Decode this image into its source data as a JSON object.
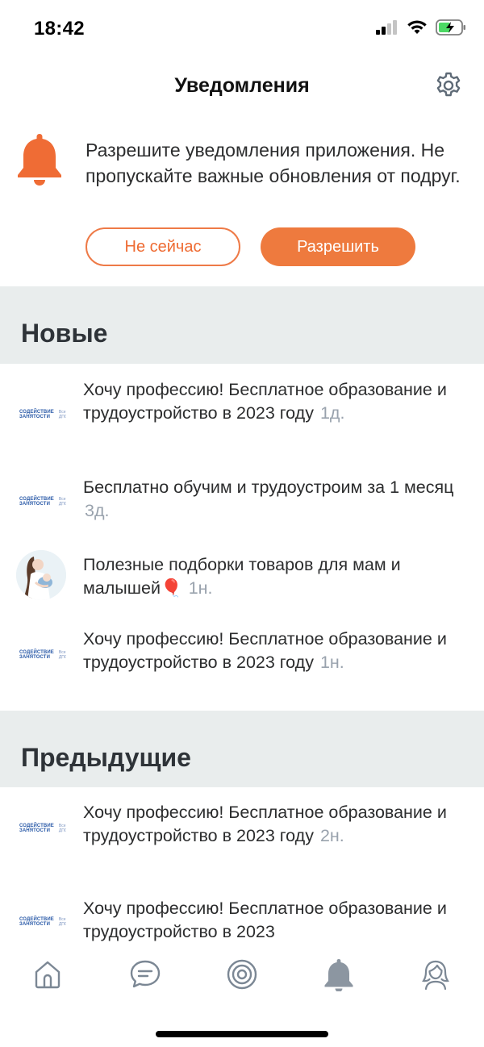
{
  "status_bar": {
    "time": "18:42"
  },
  "header": {
    "title": "Уведомления"
  },
  "banner": {
    "text": "Разрешите уведомления приложения. Не пропускайте важные обновления от подруг.",
    "later_label": "Не сейчас",
    "allow_label": "Разрешить"
  },
  "sections": {
    "new_title": "Новые",
    "previous_title": "Предыдущие"
  },
  "brand_logo": {
    "main": "СОДЕЙСТВИЕ ЗАНЯТОСТИ",
    "sub": "Все ДПО"
  },
  "notifications": [
    {
      "text": "Хочу профессию! Бесплатное образование и трудоустройство в 2023 году",
      "time": "1д."
    },
    {
      "text": "Бесплатно обучим и трудоустроим за 1 месяц",
      "time": "3д."
    },
    {
      "text": "Полезные подборки товаров для мам и малышей🎈",
      "time": "1н."
    },
    {
      "text": "Хочу профессию! Бесплатное образование и трудоустройство в 2023 году",
      "time": "1н."
    },
    {
      "text": "Хочу профессию! Бесплатное образование и трудоустройство в 2023 году",
      "time": "2н."
    },
    {
      "text": "Хочу профессию! Бесплатное образование и трудоустройство в 2023",
      "time": ""
    }
  ],
  "tabbar": {
    "icons": [
      "home-icon",
      "chat-icon",
      "target-icon",
      "bell-icon",
      "profile-icon"
    ],
    "active": "bell-icon"
  },
  "colors": {
    "accent": "#ee7a3e",
    "section_bg": "#e9eded",
    "time_text": "#99a2ad",
    "tab_icon": "#7b8794",
    "tab_active": "#8c96a1"
  }
}
